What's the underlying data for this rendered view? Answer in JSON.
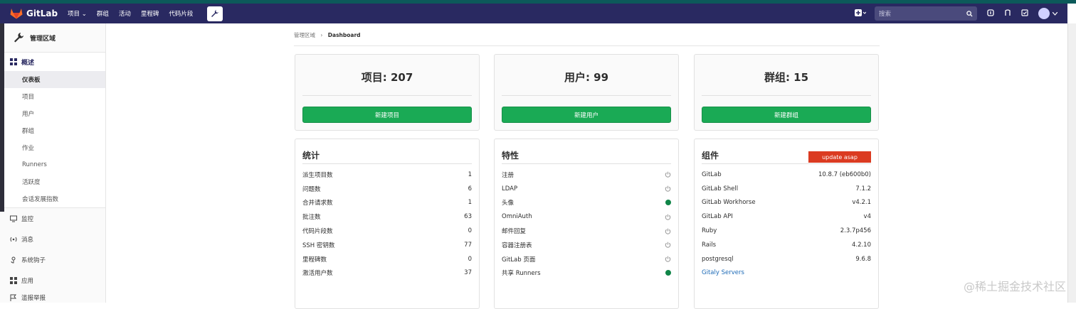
{
  "nav": {
    "brand": "GitLab",
    "links": [
      "项目 ⌄",
      "群组",
      "活动",
      "里程碑",
      "代码片段"
    ],
    "search_placeholder": "搜索",
    "accent": "#292961"
  },
  "sidebar": {
    "context_title": "管理区域",
    "overview_label": "概述",
    "overview_items": [
      "仪表板",
      "项目",
      "用户",
      "群组",
      "作业",
      "Runners",
      "活跃度",
      "会话发展指数"
    ],
    "other_items": [
      "监控",
      "消息",
      "系统钩子",
      "应用",
      "滥报举报"
    ]
  },
  "breadcrumb": {
    "parent": "管理区域",
    "separator": "›",
    "current": "Dashboard"
  },
  "stats": [
    {
      "title": "项目: 207",
      "button": "新建项目"
    },
    {
      "title": "用户: 99",
      "button": "新建用户"
    },
    {
      "title": "群组: 15",
      "button": "新建群组"
    }
  ],
  "statistics": {
    "title": "统计",
    "rows": [
      {
        "label": "派生项目数",
        "value": "1"
      },
      {
        "label": "问题数",
        "value": "6"
      },
      {
        "label": "合并请求数",
        "value": "1"
      },
      {
        "label": "批注数",
        "value": "63"
      },
      {
        "label": "代码片段数",
        "value": "0"
      },
      {
        "label": "SSH 密钥数",
        "value": "77"
      },
      {
        "label": "里程碑数",
        "value": "0"
      },
      {
        "label": "激活用户数",
        "value": "37"
      }
    ]
  },
  "features": {
    "title": "特性",
    "rows": [
      {
        "label": "注册",
        "enabled": false
      },
      {
        "label": "LDAP",
        "enabled": false
      },
      {
        "label": "头像",
        "enabled": true
      },
      {
        "label": "OmniAuth",
        "enabled": false
      },
      {
        "label": "邮件回复",
        "enabled": false
      },
      {
        "label": "容器注册表",
        "enabled": false
      },
      {
        "label": "GitLab 页面",
        "enabled": false
      },
      {
        "label": "共享 Runners",
        "enabled": true
      }
    ]
  },
  "components": {
    "title": "组件",
    "badge": "update asap",
    "rows": [
      {
        "label": "GitLab",
        "value": "10.8.7 (eb600b0)"
      },
      {
        "label": "GitLab Shell",
        "value": "7.1.2"
      },
      {
        "label": "GitLab Workhorse",
        "value": "v4.2.1"
      },
      {
        "label": "GitLab API",
        "value": "v4"
      },
      {
        "label": "Ruby",
        "value": "2.3.7p456"
      },
      {
        "label": "Rails",
        "value": "4.2.10"
      },
      {
        "label": "postgresql",
        "value": "9.6.8"
      }
    ],
    "link": "Gitaly Servers"
  },
  "watermark": "@稀土掘金技术社区"
}
